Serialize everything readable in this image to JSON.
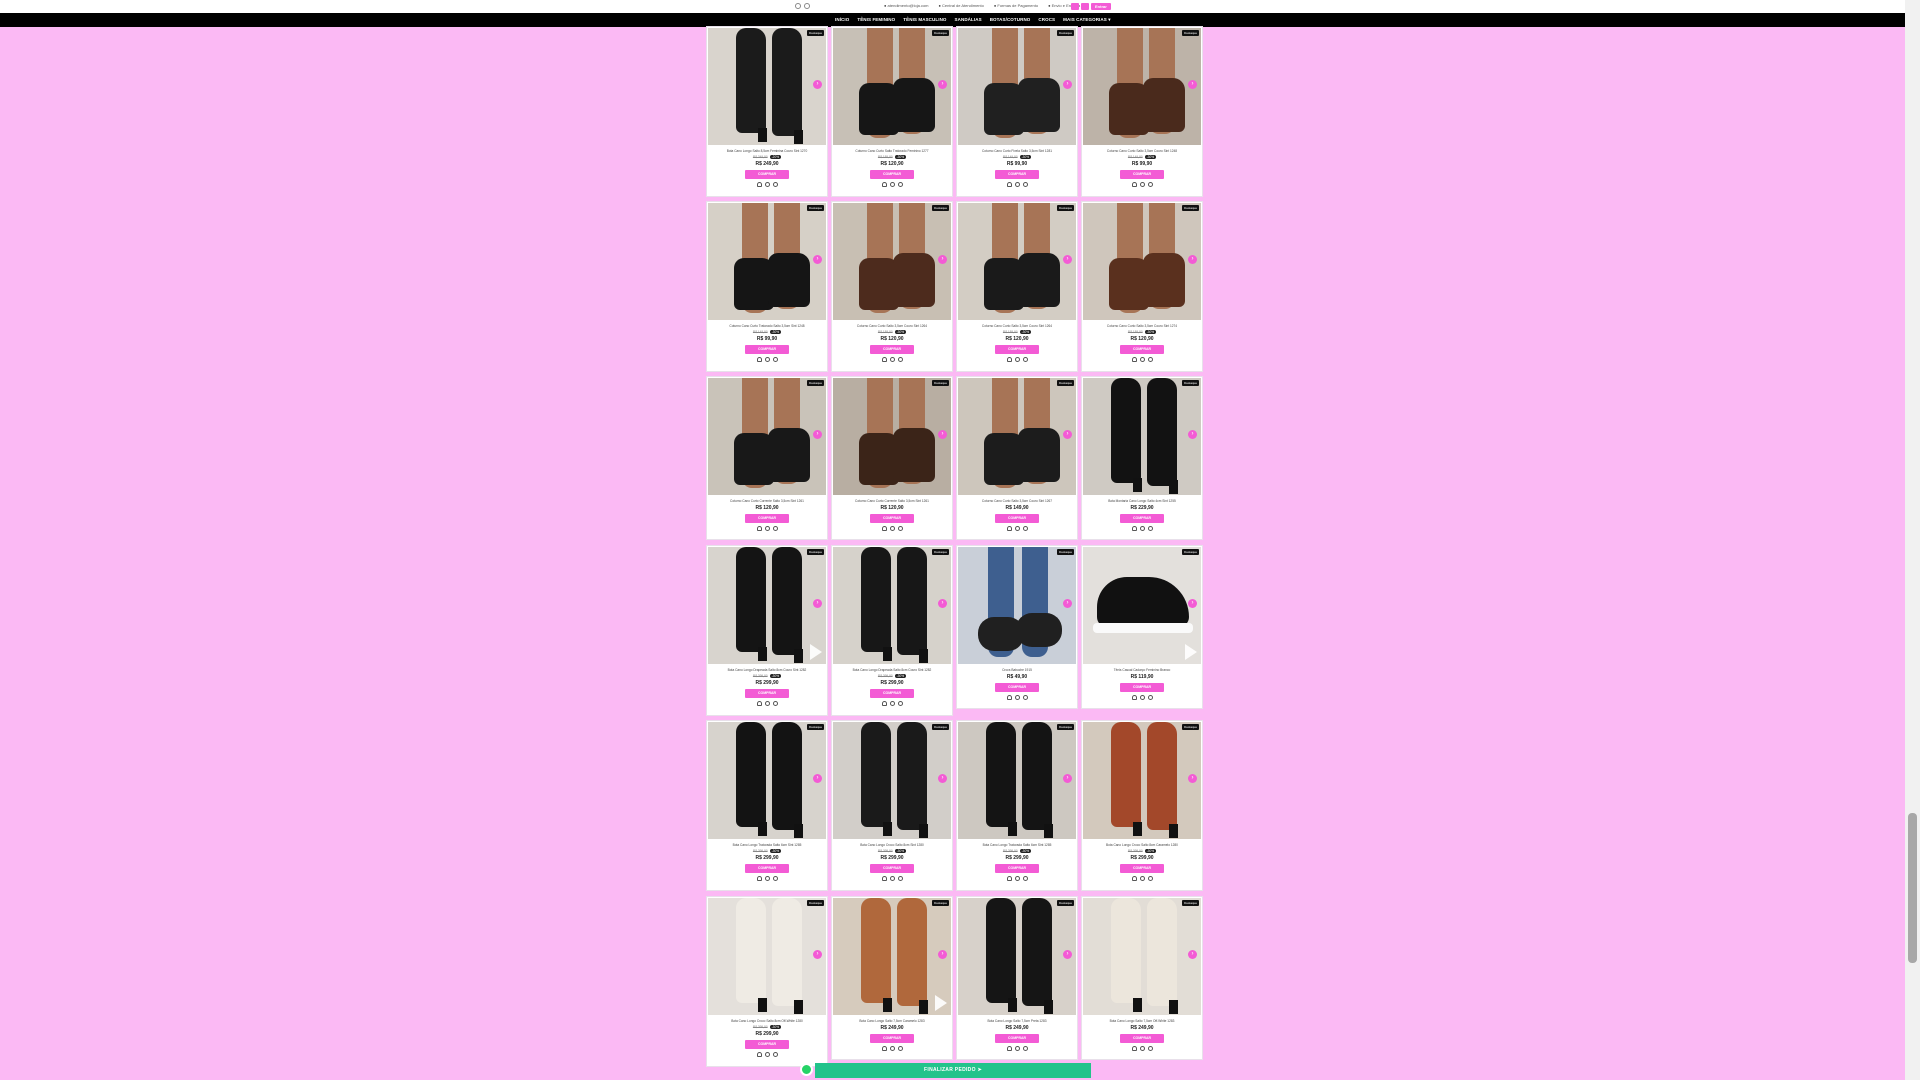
{
  "topbar": {
    "info": [
      "atendimento@loja.com",
      "Central de Atendimento",
      "Formas de Pagamento",
      "Envio e Entrega"
    ],
    "login_label": "Entrar"
  },
  "nav": [
    "INÍCIO",
    "TÊNIS FEMININO",
    "TÊNIS MASCULINO",
    "SANDÁLIAS",
    "BOTAS/COTURNO",
    "CROCS",
    "MAIS CATEGORIAS ▾"
  ],
  "labels": {
    "buy": "COMPRAR",
    "badge": "Destaque",
    "finish": "FINALIZAR PEDIDO ➤"
  },
  "colors": {
    "accent": "#f35bd5",
    "background": "#fbb9f4",
    "finish": "#23c38b"
  },
  "products": [
    {
      "title": "Bota Cano Longo Salto 8,5cm Feminina Couro Sint 1270",
      "old": "R$ 349,90",
      "off": "-20%",
      "price": "R$ 249,90",
      "video": false
    },
    {
      "title": "Coturno Cano Curto Salto Tratorado Feminino 1277",
      "old": "R$ 189,90",
      "off": "-30%",
      "price": "R$ 120,90",
      "video": false
    },
    {
      "title": "Coturno Cano Curto Fivela Salto 3,5cm Sint 1281",
      "old": "R$ 149,90",
      "off": "-30%",
      "price": "R$ 99,90",
      "video": false
    },
    {
      "title": "Coturno Cano Curto Salto 3,5cm Couro Sint 1248",
      "old": "R$ 149,90",
      "off": "-30%",
      "price": "R$ 99,90",
      "video": false
    },
    {
      "title": "Coturno Cano Curto Tratorado Salto 3,5cm Sint 1248",
      "old": "R$ 149,90",
      "off": "-30%",
      "price": "R$ 99,90",
      "video": false
    },
    {
      "title": "Coturno Cano Curto Salto 3,5cm Couro Sint 1264",
      "old": "R$ 189,90",
      "off": "-30%",
      "price": "R$ 120,90",
      "video": false
    },
    {
      "title": "Coturno Cano Curto Salto 3,5cm Couro Sint 1264",
      "old": "R$ 189,90",
      "off": "-30%",
      "price": "R$ 120,90",
      "video": false
    },
    {
      "title": "Coturno Cano Curto Salto 3,5cm Couro Sint 1274",
      "old": "R$ 189,90",
      "off": "-30%",
      "price": "R$ 120,90",
      "video": false
    },
    {
      "title": "Coturno Cano Curto Corrente Salto 3,5cm Sint 1261",
      "old": "",
      "off": "",
      "price": "R$ 120,90",
      "video": false
    },
    {
      "title": "Coturno Cano Curto Corrente Salto 3,5cm Sint 1261",
      "old": "",
      "off": "",
      "price": "R$ 120,90",
      "video": false
    },
    {
      "title": "Coturno Cano Curto Salto 3,5cm Couro Sint 1267",
      "old": "",
      "off": "",
      "price": "R$ 149,90",
      "video": false
    },
    {
      "title": "Bota Montaria Cano Longo Salto 4cm Sint 1255",
      "old": "",
      "off": "",
      "price": "R$ 229,90",
      "video": false
    },
    {
      "title": "Bota Cano Longo Drapeada Salto 8cm Couro Sint 1282",
      "old": "R$ 399,90",
      "off": "-30%",
      "price": "R$ 299,90",
      "video": true
    },
    {
      "title": "Bota Cano Longo Drapeada Salto 8cm Couro Sint 1282",
      "old": "R$ 399,90",
      "off": "-30%",
      "price": "R$ 299,90",
      "video": false
    },
    {
      "title": "Crocs Babuche 1915",
      "old": "",
      "off": "",
      "price": "R$ 49,90",
      "video": false
    },
    {
      "title": "Tênis Casual Cadarço Feminino Branco",
      "old": "",
      "off": "",
      "price": "R$ 119,90",
      "video": true
    },
    {
      "title": "Bota Cano Longo Tratorada Salto 6cm Sint 1285",
      "old": "R$ 399,90",
      "off": "-30%",
      "price": "R$ 299,90",
      "video": false
    },
    {
      "title": "Bota Cano Longo Croco Salto 8cm Sint 1280",
      "old": "R$ 399,90",
      "off": "-30%",
      "price": "R$ 299,90",
      "video": false
    },
    {
      "title": "Bota Cano Longo Tratorada Salto 6cm Sint 1285",
      "old": "R$ 399,90",
      "off": "-30%",
      "price": "R$ 299,90",
      "video": false
    },
    {
      "title": "Bota Cano Longo Croco Salto 8cm Caramelo 1280",
      "old": "R$ 399,90",
      "off": "-30%",
      "price": "R$ 299,90",
      "video": false
    },
    {
      "title": "Bota Cano Longo Croco Salto 8cm Off-White 1280",
      "old": "R$ 399,90",
      "off": "-30%",
      "price": "R$ 299,90",
      "video": false
    },
    {
      "title": "Bota Cano Longo Salto 7,5cm Caramelo 1283",
      "old": "",
      "off": "",
      "price": "R$ 249,90",
      "video": true
    },
    {
      "title": "Bota Cano Longo Salto 7,5cm Preta 1283",
      "old": "",
      "off": "",
      "price": "R$ 249,90",
      "video": false
    },
    {
      "title": "Bota Cano Longo Salto 7,5cm Off-White 1283",
      "old": "",
      "off": "",
      "price": "R$ 249,90",
      "video": false
    }
  ]
}
